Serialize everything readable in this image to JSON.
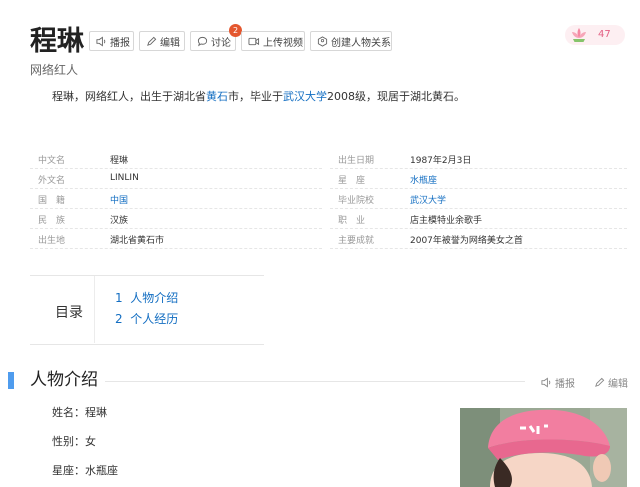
{
  "header": {
    "title": "程琳",
    "subtitle": "网络红人",
    "buttons": {
      "broadcast": "播报",
      "edit": "编辑",
      "discuss": "讨论",
      "discuss_badge": "2",
      "upload_video": "上传视频",
      "create_relation": "创建人物关系"
    },
    "likes": "47"
  },
  "summary": {
    "p1": "程琳，网络红人，出生于湖北省",
    "link1": "黄石",
    "p2": "市，毕业于",
    "link2": "武汉大学",
    "p3": "2008级，现居于湖北黄石。"
  },
  "basic_info": {
    "left": [
      {
        "label": "中文名",
        "value": "程琳"
      },
      {
        "label": "外文名",
        "value": "LINLIN"
      },
      {
        "label": "国　籍",
        "value": "中国"
      },
      {
        "label": "民　族",
        "value": "汉族"
      },
      {
        "label": "出生地",
        "value": "湖北省黄石市"
      }
    ],
    "right": [
      {
        "label": "出生日期",
        "value": "1987年2月3日"
      },
      {
        "label": "星　座",
        "value": "水瓶座"
      },
      {
        "label": "毕业院校",
        "value": "武汉大学"
      },
      {
        "label": "职　业",
        "value": "店主模特业余歌手"
      },
      {
        "label": "主要成就",
        "value": "2007年被誉为网络美女之首"
      }
    ]
  },
  "catalog": {
    "label": "目录",
    "items": [
      {
        "num": "1",
        "text": "人物介绍"
      },
      {
        "num": "2",
        "text": "个人经历"
      }
    ]
  },
  "section": {
    "title": "人物介绍",
    "broadcast": "播报",
    "edit": "编辑",
    "lines": [
      "姓名：程琳",
      "性别：女",
      "星座：水瓶座"
    ]
  },
  "colors": {
    "link": "#136ec2",
    "accent": "#4f9cee",
    "badge": "#e4572e",
    "likes": "#e35f83"
  },
  "icons": [
    "speaker-icon",
    "pencil-icon",
    "chat-bubble-icon",
    "video-icon",
    "relation-icon",
    "lotus-icon"
  ]
}
